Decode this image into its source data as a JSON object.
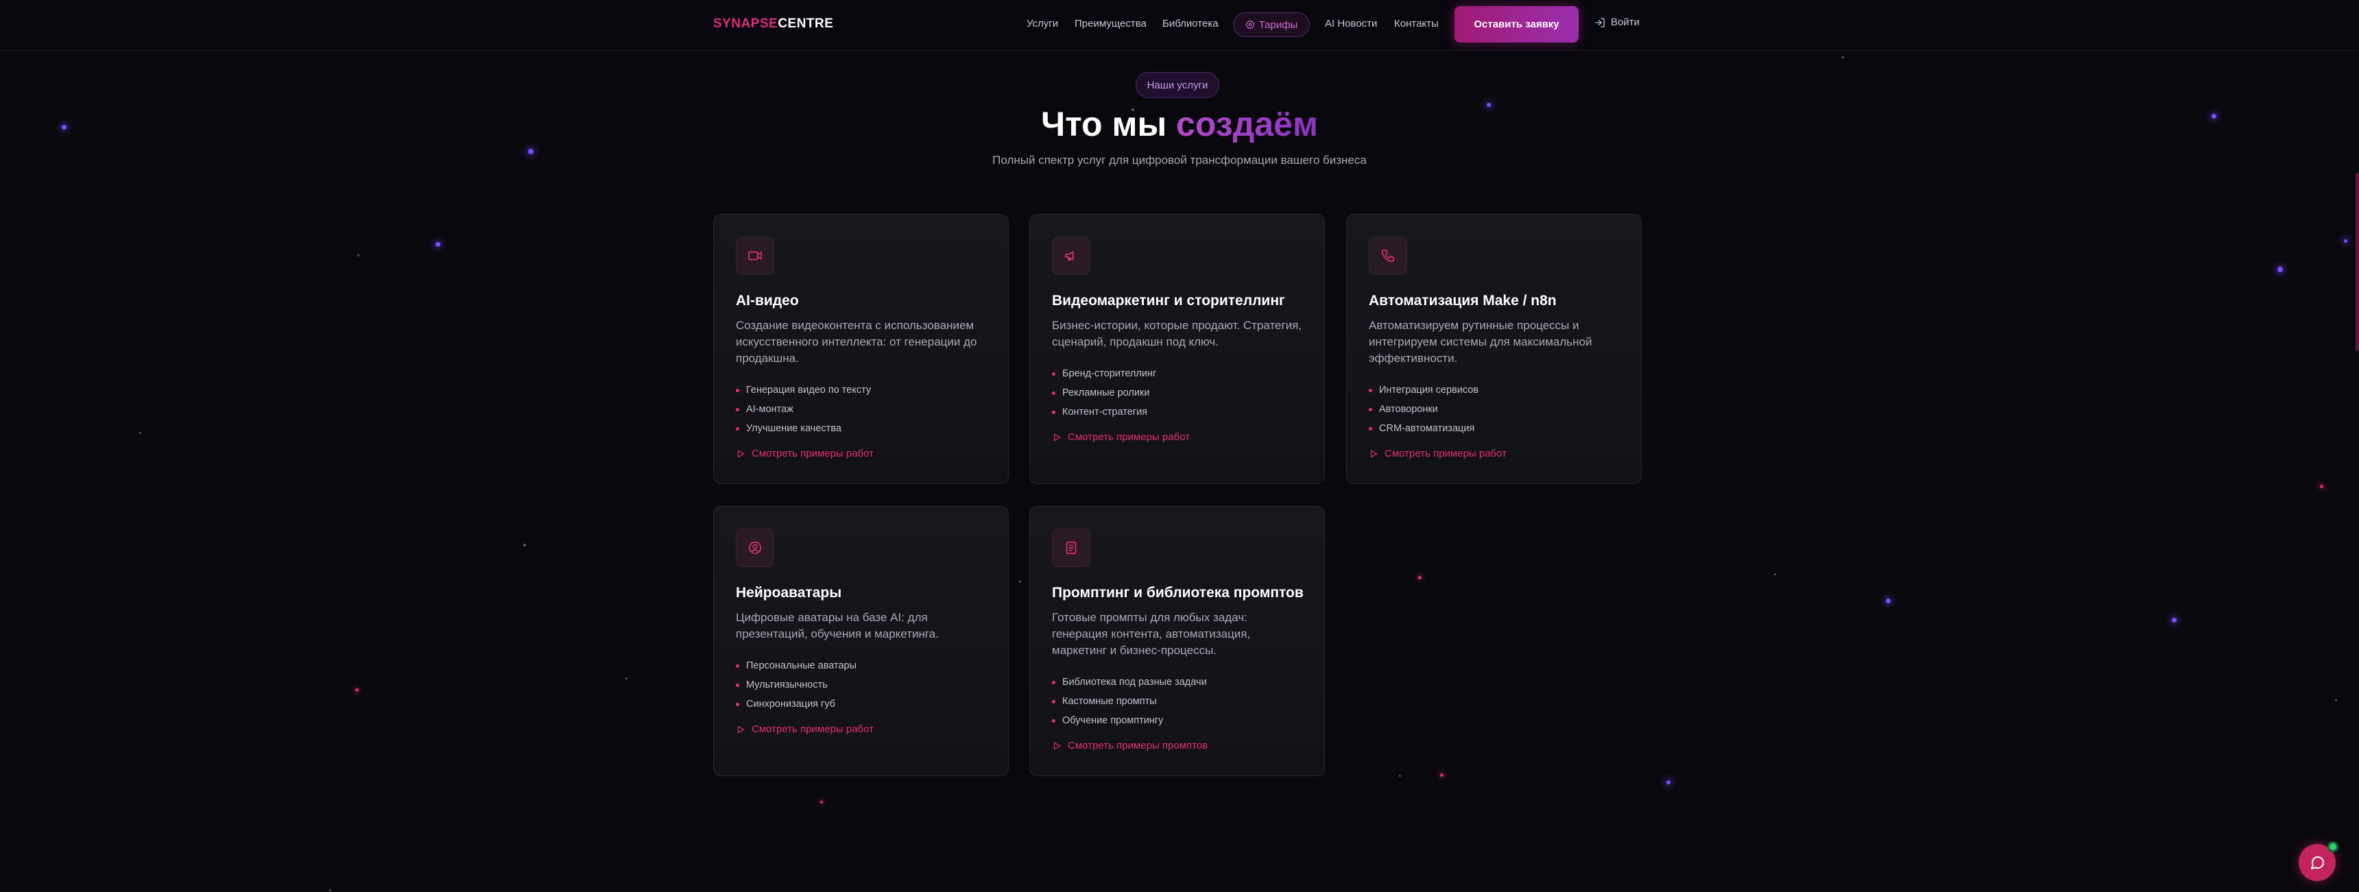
{
  "logo": {
    "part1": "SYNAPSE",
    "part2": "CENTRE"
  },
  "nav": {
    "services": "Услуги",
    "advantages": "Преимущества",
    "library": "Библиотека",
    "tariffs": "Тарифы",
    "ai_news": "AI Новости",
    "contacts": "Контакты",
    "cta": "Оставить заявку",
    "login": "Войти"
  },
  "hero": {
    "badge": "Наши услуги",
    "title_plain": "Что мы ",
    "title_accent": "создаём",
    "subtitle": "Полный спектр услуг для цифровой трансформации вашего бизнеса"
  },
  "services": [
    {
      "icon": "video-icon",
      "title": "AI-видео",
      "description": "Создание видеоконтента с использованием искусственного интеллекта: от генерации до продакшна.",
      "features": [
        "Генерация видео по тексту",
        "AI-монтаж",
        "Улучшение качества"
      ],
      "link": "Смотреть примеры работ"
    },
    {
      "icon": "megaphone-icon",
      "title": "Видеомаркетинг и сторителлинг",
      "description": "Бизнес-истории, которые продают. Стратегия, сценарий, продакшн под ключ.",
      "features": [
        "Бренд-сторителлинг",
        "Рекламные ролики",
        "Контент-стратегия"
      ],
      "link": "Смотреть примеры работ"
    },
    {
      "icon": "phone-icon",
      "title": "Автоматизация Make / n8n",
      "description": "Автоматизируем рутинные процессы и интегрируем системы для максимальной эффективности.",
      "features": [
        "Интеграция сервисов",
        "Автоворонки",
        "CRM-автоматизация"
      ],
      "link": "Смотреть примеры работ"
    },
    {
      "icon": "user-circle-icon",
      "title": "Нейроаватары",
      "description": "Цифровые аватары на базе AI: для презентаций, обучения и маркетинга.",
      "features": [
        "Персональные аватары",
        "Мультиязычность",
        "Синхронизация губ"
      ],
      "link": "Смотреть примеры работ"
    },
    {
      "icon": "document-icon",
      "title": "Промптинг и библиотека промптов",
      "description": "Готовые промпты для любых задач: генерация контента, автоматизация, маркетинг и бизнес-процессы.",
      "features": [
        "Библиотека под разные задачи",
        "Кастомные промпты",
        "Обучение промптингу"
      ],
      "link": "Смотреть примеры промптов"
    }
  ],
  "colors": {
    "accent": "#e0306e",
    "brand_purple": "#9b2fae",
    "background": "#09080d"
  }
}
